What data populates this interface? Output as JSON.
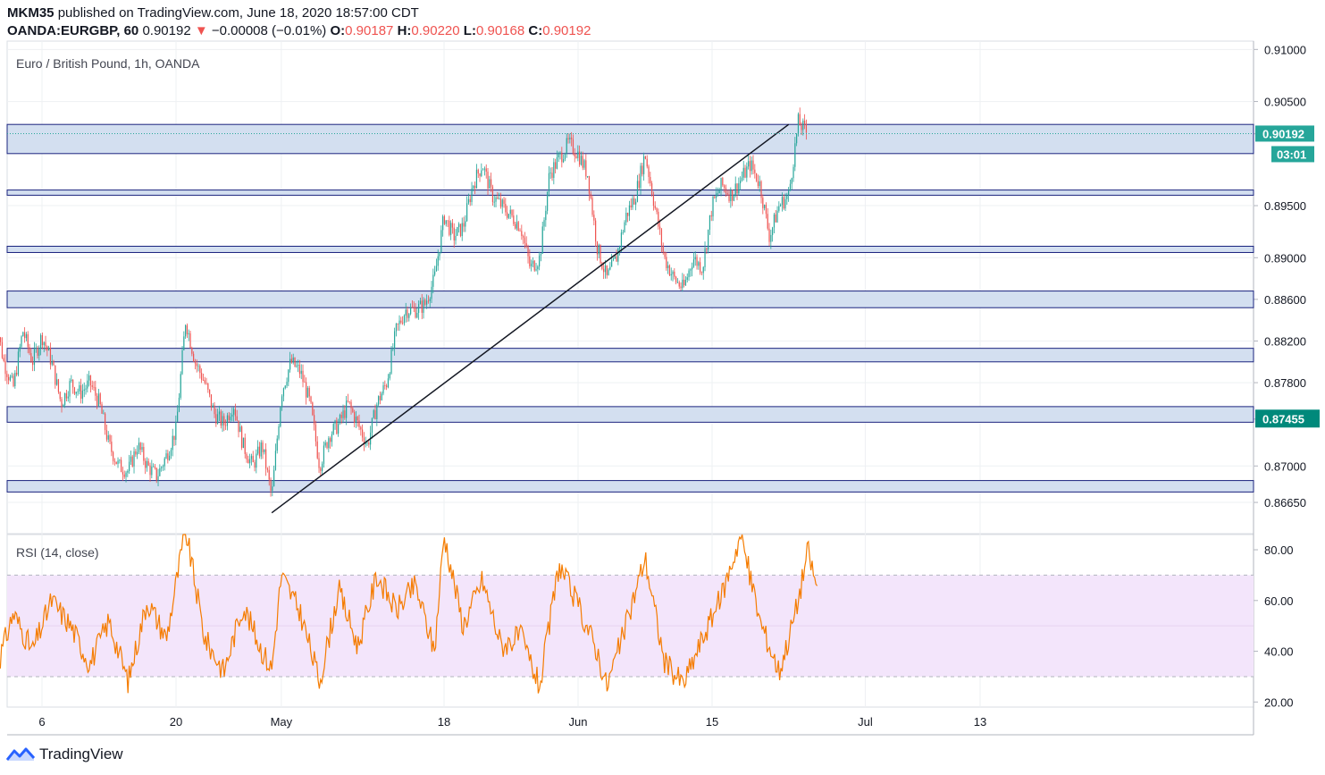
{
  "header": {
    "publisher": "MKM35",
    "published_text": "published on TradingView.com, June 18, 2020 18:57:00 CDT",
    "symbol": "OANDA:EURGBP, 60",
    "last": "0.90192",
    "change_arrow": "▼",
    "change": "−0.00008 (−0.01%)",
    "o_label": "O:",
    "o_value": "0.90187",
    "h_label": "H:",
    "h_value": "0.90220",
    "l_label": "L:",
    "l_value": "0.90168",
    "c_label": "C:",
    "c_value": "0.90192"
  },
  "footer": {
    "brand": "TradingView",
    "logo_icon": "tradingview-logo-icon"
  },
  "colors": {
    "up": "#26a69a",
    "down": "#ef5350",
    "zone_fill": "#d3dff0",
    "zone_border": "#1a237e",
    "rsi_line": "#f57c00",
    "rsi_band": "#f3e5fb",
    "price_badge": "#26a69a",
    "level_badge": "#00897b"
  },
  "chart_data": [
    {
      "type": "candlestick",
      "title": "Euro / British Pound, 1h, OANDA",
      "x_ticks": [
        "6",
        "20",
        "May",
        "18",
        "Jun",
        "15",
        "Jul",
        "13"
      ],
      "y_ticks": [
        0.91,
        0.905,
        0.9019,
        0.895,
        0.89,
        0.886,
        0.882,
        0.878,
        0.8745,
        0.87,
        0.8665
      ],
      "y_tick_labels": [
        "0.91000",
        "0.90500",
        "0.90",
        "0.89500",
        "0.89000",
        "0.88600",
        "0.88200",
        "0.87800",
        "0.87400",
        "0.87000",
        "0.86650"
      ],
      "ylim": [
        0.8635,
        0.9108
      ],
      "current_price": {
        "value": 0.90192,
        "label": "0.90192",
        "countdown": "03:01"
      },
      "marked_level": {
        "value": 0.87455,
        "label": "0.87455"
      },
      "zones": [
        {
          "low": 0.9,
          "high": 0.9028
        },
        {
          "low": 0.896,
          "high": 0.8965
        },
        {
          "low": 0.8905,
          "high": 0.8911
        },
        {
          "low": 0.8852,
          "high": 0.8868
        },
        {
          "low": 0.88,
          "high": 0.8813
        },
        {
          "low": 0.8742,
          "high": 0.8757
        },
        {
          "low": 0.8675,
          "high": 0.8686
        }
      ],
      "trendline": {
        "from": {
          "date": "2020-04-30",
          "price": 0.8655
        },
        "to": {
          "date": "2020-06-23",
          "price": 0.9028
        }
      },
      "path": [
        [
          "2020-04-01",
          0.885
        ],
        [
          "2020-04-02",
          0.88
        ],
        [
          "2020-04-03",
          0.8775
        ],
        [
          "2020-04-04",
          0.883
        ],
        [
          "2020-04-05",
          0.88
        ],
        [
          "2020-04-06",
          0.8825
        ],
        [
          "2020-04-07",
          0.88
        ],
        [
          "2020-04-08",
          0.876
        ],
        [
          "2020-04-09",
          0.878
        ],
        [
          "2020-04-10",
          0.877
        ],
        [
          "2020-04-11",
          0.878
        ],
        [
          "2020-04-12",
          0.876
        ],
        [
          "2020-04-13",
          0.872
        ],
        [
          "2020-04-14",
          0.87
        ],
        [
          "2020-04-15",
          0.8695
        ],
        [
          "2020-04-16",
          0.872
        ],
        [
          "2020-04-17",
          0.87
        ],
        [
          "2020-04-18",
          0.869
        ],
        [
          "2020-04-19",
          0.871
        ],
        [
          "2020-04-20",
          0.8735
        ],
        [
          "2020-04-21",
          0.884
        ],
        [
          "2020-04-22",
          0.88
        ],
        [
          "2020-04-23",
          0.878
        ],
        [
          "2020-04-24",
          0.875
        ],
        [
          "2020-04-25",
          0.874
        ],
        [
          "2020-04-26",
          0.876
        ],
        [
          "2020-04-27",
          0.872
        ],
        [
          "2020-04-28",
          0.87
        ],
        [
          "2020-04-29",
          0.872
        ],
        [
          "2020-04-30",
          0.867
        ],
        [
          "2020-05-01",
          0.877
        ],
        [
          "2020-05-02",
          0.88
        ],
        [
          "2020-05-03",
          0.879
        ],
        [
          "2020-05-04",
          0.876
        ],
        [
          "2020-05-05",
          0.87
        ],
        [
          "2020-05-06",
          0.873
        ],
        [
          "2020-05-07",
          0.874
        ],
        [
          "2020-05-08",
          0.876
        ],
        [
          "2020-05-09",
          0.874
        ],
        [
          "2020-05-10",
          0.872
        ],
        [
          "2020-05-11",
          0.876
        ],
        [
          "2020-05-12",
          0.878
        ],
        [
          "2020-05-13",
          0.883
        ],
        [
          "2020-05-14",
          0.885
        ],
        [
          "2020-05-15",
          0.885
        ],
        [
          "2020-05-16",
          0.8855
        ],
        [
          "2020-05-17",
          0.888
        ],
        [
          "2020-05-18",
          0.894
        ],
        [
          "2020-05-19",
          0.892
        ],
        [
          "2020-05-20",
          0.893
        ],
        [
          "2020-05-21",
          0.897
        ],
        [
          "2020-05-22",
          0.899
        ],
        [
          "2020-05-23",
          0.896
        ],
        [
          "2020-05-24",
          0.895
        ],
        [
          "2020-05-25",
          0.894
        ],
        [
          "2020-05-26",
          0.893
        ],
        [
          "2020-05-27",
          0.889
        ],
        [
          "2020-05-28",
          0.89
        ],
        [
          "2020-05-29",
          0.898
        ],
        [
          "2020-05-30",
          0.8995
        ],
        [
          "2020-05-31",
          0.901
        ],
        [
          "2020-06-01",
          0.9
        ],
        [
          "2020-06-02",
          0.898
        ],
        [
          "2020-06-03",
          0.891
        ],
        [
          "2020-06-04",
          0.888
        ],
        [
          "2020-06-05",
          0.89
        ],
        [
          "2020-06-06",
          0.894
        ],
        [
          "2020-06-07",
          0.896
        ],
        [
          "2020-06-08",
          0.9
        ],
        [
          "2020-06-09",
          0.895
        ],
        [
          "2020-06-10",
          0.89
        ],
        [
          "2020-06-11",
          0.888
        ],
        [
          "2020-06-12",
          0.887
        ],
        [
          "2020-06-13",
          0.89
        ],
        [
          "2020-06-14",
          0.889
        ],
        [
          "2020-06-15",
          0.895
        ],
        [
          "2020-06-16",
          0.897
        ],
        [
          "2020-06-17",
          0.896
        ],
        [
          "2020-06-18",
          0.8975
        ],
        [
          "2020-06-19",
          0.899
        ],
        [
          "2020-06-20",
          0.897
        ],
        [
          "2020-06-21",
          0.892
        ],
        [
          "2020-06-22",
          0.895
        ],
        [
          "2020-06-23",
          0.896
        ],
        [
          "2020-06-24",
          0.903
        ],
        [
          "2020-06-25",
          0.9019
        ]
      ]
    },
    {
      "type": "line",
      "title": "RSI (14, close)",
      "y_ticks": [
        80,
        60,
        40,
        20
      ],
      "y_tick_labels": [
        "80.00",
        "60.00",
        "40.00",
        "20.00"
      ],
      "ylim": [
        18,
        86
      ],
      "bands": {
        "upper": 70,
        "lower": 30
      },
      "path": [
        [
          "2020-04-01",
          30
        ],
        [
          "2020-04-03",
          55
        ],
        [
          "2020-04-05",
          40
        ],
        [
          "2020-04-07",
          60
        ],
        [
          "2020-04-09",
          50
        ],
        [
          "2020-04-11",
          35
        ],
        [
          "2020-04-13",
          52
        ],
        [
          "2020-04-15",
          28
        ],
        [
          "2020-04-17",
          60
        ],
        [
          "2020-04-19",
          45
        ],
        [
          "2020-04-21",
          88
        ],
        [
          "2020-04-23",
          45
        ],
        [
          "2020-04-25",
          32
        ],
        [
          "2020-04-27",
          58
        ],
        [
          "2020-04-29",
          40
        ],
        [
          "2020-04-30",
          33
        ],
        [
          "2020-05-01",
          70
        ],
        [
          "2020-05-03",
          55
        ],
        [
          "2020-05-05",
          28
        ],
        [
          "2020-05-07",
          64
        ],
        [
          "2020-05-09",
          42
        ],
        [
          "2020-05-11",
          70
        ],
        [
          "2020-05-13",
          56
        ],
        [
          "2020-05-15",
          66
        ],
        [
          "2020-05-17",
          40
        ],
        [
          "2020-05-18",
          86
        ],
        [
          "2020-05-20",
          50
        ],
        [
          "2020-05-22",
          68
        ],
        [
          "2020-05-24",
          42
        ],
        [
          "2020-05-26",
          46
        ],
        [
          "2020-05-28",
          26
        ],
        [
          "2020-05-30",
          74
        ],
        [
          "2020-06-01",
          58
        ],
        [
          "2020-06-03",
          40
        ],
        [
          "2020-06-04",
          26
        ],
        [
          "2020-06-06",
          50
        ],
        [
          "2020-06-08",
          77
        ],
        [
          "2020-06-10",
          36
        ],
        [
          "2020-06-12",
          27
        ],
        [
          "2020-06-14",
          45
        ],
        [
          "2020-06-16",
          62
        ],
        [
          "2020-06-18",
          86
        ],
        [
          "2020-06-20",
          52
        ],
        [
          "2020-06-22",
          32
        ],
        [
          "2020-06-23",
          45
        ],
        [
          "2020-06-24",
          60
        ],
        [
          "2020-06-25",
          80
        ],
        [
          "2020-06-26",
          64
        ]
      ]
    }
  ]
}
